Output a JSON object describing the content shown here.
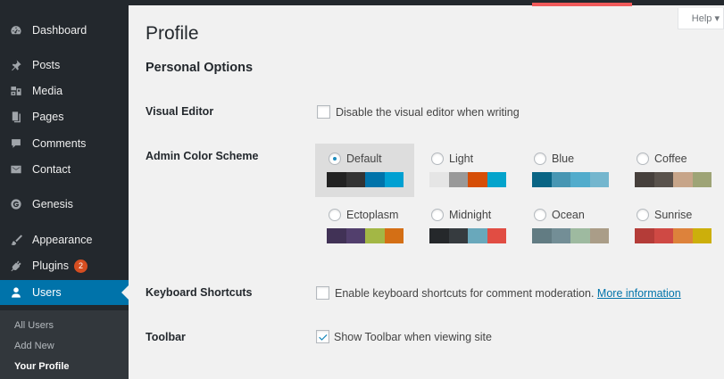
{
  "sidebar": {
    "items": [
      {
        "label": "Dashboard",
        "icon": "dashboard-icon"
      },
      {
        "label": "Posts",
        "icon": "pin-icon"
      },
      {
        "label": "Media",
        "icon": "media-icon"
      },
      {
        "label": "Pages",
        "icon": "pages-icon"
      },
      {
        "label": "Comments",
        "icon": "comment-icon"
      },
      {
        "label": "Contact",
        "icon": "mail-icon"
      },
      {
        "label": "Genesis",
        "icon": "genesis-icon"
      },
      {
        "label": "Appearance",
        "icon": "brush-icon"
      },
      {
        "label": "Plugins",
        "icon": "plugin-icon",
        "badge": "2"
      },
      {
        "label": "Users",
        "icon": "user-icon",
        "active": true
      }
    ],
    "submenu": [
      {
        "label": "All Users"
      },
      {
        "label": "Add New"
      },
      {
        "label": "Your Profile",
        "current": true
      }
    ]
  },
  "header": {
    "help_label": "Help ▾",
    "page_title": "Profile",
    "section_title": "Personal Options"
  },
  "visual_editor": {
    "label": "Visual Editor",
    "option": "Disable the visual editor when writing",
    "checked": false
  },
  "color_scheme": {
    "label": "Admin Color Scheme",
    "schemes": [
      {
        "name": "Default",
        "selected": true,
        "colors": [
          "#222222",
          "#333333",
          "#0073aa",
          "#00a0d2"
        ]
      },
      {
        "name": "Light",
        "selected": false,
        "colors": [
          "#e5e5e5",
          "#999999",
          "#d64e07",
          "#04a4cc"
        ]
      },
      {
        "name": "Blue",
        "selected": false,
        "colors": [
          "#096484",
          "#4796b3",
          "#52accc",
          "#74b6ce"
        ]
      },
      {
        "name": "Coffee",
        "selected": false,
        "colors": [
          "#46403c",
          "#59524c",
          "#c7a589",
          "#9ea476"
        ]
      },
      {
        "name": "Ectoplasm",
        "selected": false,
        "colors": [
          "#413256",
          "#523f6d",
          "#a3b745",
          "#d46f15"
        ]
      },
      {
        "name": "Midnight",
        "selected": false,
        "colors": [
          "#25282b",
          "#363b3f",
          "#69a8bb",
          "#e14d43"
        ]
      },
      {
        "name": "Ocean",
        "selected": false,
        "colors": [
          "#627c83",
          "#738e96",
          "#9ebaa0",
          "#aa9d88"
        ]
      },
      {
        "name": "Sunrise",
        "selected": false,
        "colors": [
          "#b43c38",
          "#cf4944",
          "#dd823b",
          "#ccaf0b"
        ]
      }
    ]
  },
  "keyboard_shortcuts": {
    "label": "Keyboard Shortcuts",
    "option": "Enable keyboard shortcuts for comment moderation.",
    "link": "More information",
    "checked": false
  },
  "toolbar": {
    "label": "Toolbar",
    "option": "Show Toolbar when viewing site",
    "checked": true
  },
  "colors": {
    "sidebar_bg": "#23282d",
    "accent": "#0073aa",
    "top_accent": "#f05a5a",
    "badge": "#d54e21"
  }
}
